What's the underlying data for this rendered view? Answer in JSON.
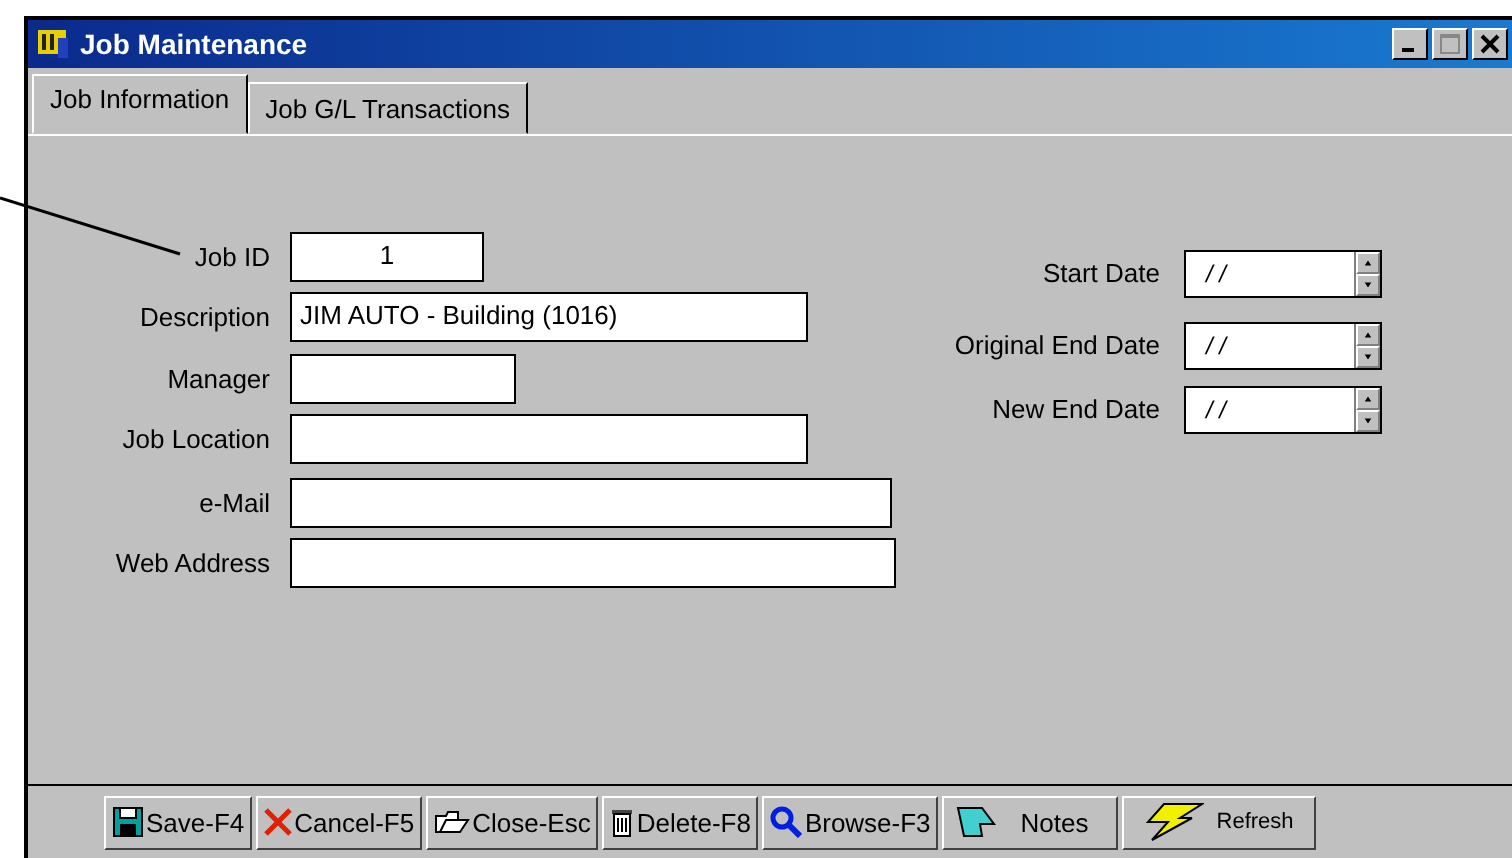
{
  "window": {
    "title": "Job Maintenance"
  },
  "tabs": [
    {
      "label": "Job Information",
      "selected": true
    },
    {
      "label": "Job G/L Transactions",
      "selected": false
    }
  ],
  "left_fields": [
    {
      "label": "Job ID",
      "value": "1",
      "kind": "number"
    },
    {
      "label": "Description",
      "value": "JIM AUTO - Building (1016)",
      "kind": "text"
    },
    {
      "label": "Manager",
      "kind": "text"
    },
    {
      "label": "Job Location",
      "kind": "text"
    },
    {
      "label": "e-Mail",
      "kind": "text"
    },
    {
      "label": "Web Address",
      "kind": "text"
    }
  ],
  "date_fields": [
    {
      "label": "Start Date",
      "value": "/ /"
    },
    {
      "label": "Original End Date",
      "value": "/ /"
    },
    {
      "label": "New End Date",
      "value": "/ /"
    }
  ],
  "buttons": [
    "Save-F4",
    "Cancel-F5",
    "Close-Esc",
    "Delete-F8",
    "Browse-F3",
    "Notes",
    "Refresh"
  ]
}
